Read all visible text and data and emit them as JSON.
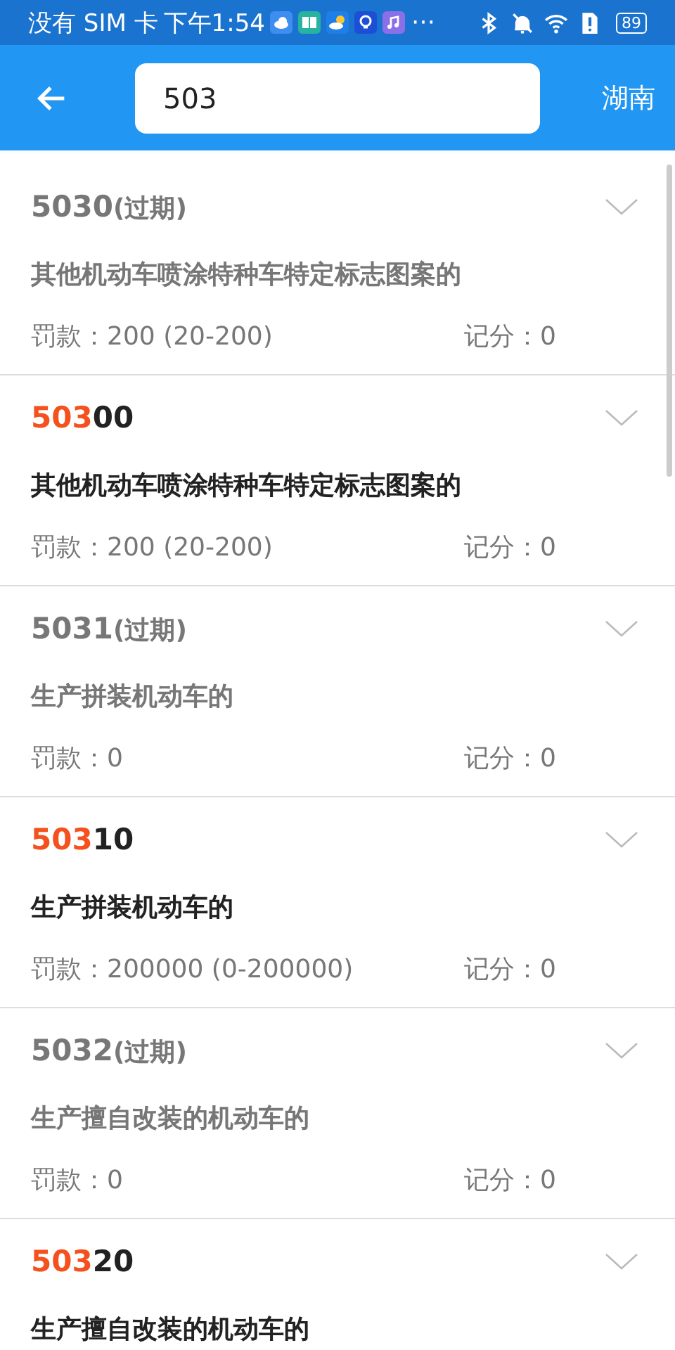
{
  "status_bar": {
    "carrier": "没有 SIM 卡",
    "time": "下午1:54",
    "more": "⋯",
    "battery": "89"
  },
  "header": {
    "search_value": "503",
    "region": "湖南"
  },
  "results": [
    {
      "code_match": "503",
      "code_rest": "0",
      "expired": true,
      "tag": "(过期)",
      "title": "其他机动车喷涂特种车特定标志图案的",
      "fine": "罚款：200 (20-200)",
      "points": "记分：0"
    },
    {
      "code_match": "503",
      "code_rest": "00",
      "expired": false,
      "title": "其他机动车喷涂特种车特定标志图案的",
      "fine": "罚款：200 (20-200)",
      "points": "记分：0"
    },
    {
      "code_match": "503",
      "code_rest": "1",
      "expired": true,
      "tag": "(过期)",
      "title": "生产拼装机动车的",
      "fine": "罚款：0",
      "points": "记分：0"
    },
    {
      "code_match": "503",
      "code_rest": "10",
      "expired": false,
      "title": "生产拼装机动车的",
      "fine": "罚款：200000 (0-200000)",
      "points": "记分：0"
    },
    {
      "code_match": "503",
      "code_rest": "2",
      "expired": true,
      "tag": "(过期)",
      "title": "生产擅自改装的机动车的",
      "fine": "罚款：0",
      "points": "记分：0"
    },
    {
      "code_match": "503",
      "code_rest": "20",
      "expired": false,
      "title": "生产擅自改装的机动车的"
    }
  ]
}
